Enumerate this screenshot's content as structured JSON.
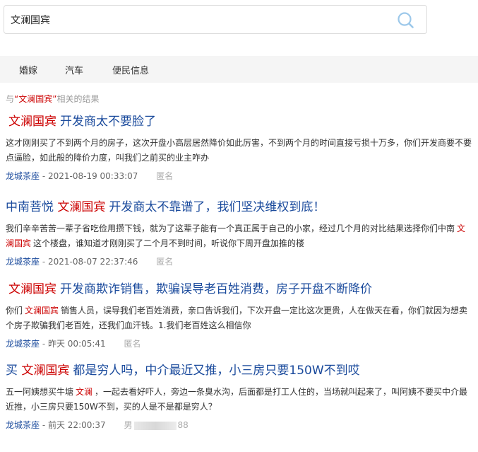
{
  "search": {
    "value": "文澜国宾",
    "button_icon": "search-icon"
  },
  "tabs": [
    "婚嫁",
    "汽车",
    "便民信息"
  ],
  "summary": {
    "prefix": "与",
    "query_quoted": "“文澜国宾”",
    "suffix": "相关的结果"
  },
  "results": [
    {
      "title_pre": "",
      "title_hl": "文澜国宾",
      "title_post": "开发商太不要脸了",
      "snippet": [
        {
          "t": "text",
          "v": "这才刚刚买了不到两个月的房子，这次开盘小高层居然降价如此厉害，不到两个月的时间直接亏损十万多，你们开发商要不要点逼脸，如此般的降价力度，叫我们之前买的业主咋办"
        }
      ],
      "author": "龙城茶座",
      "time": "2021-08-19 00:33:07",
      "anon": "匿名"
    },
    {
      "title_pre": "中南菩悦",
      "title_hl": "文澜国宾",
      "title_post": "开发商太不靠谱了，我们坚决维权到底！",
      "snippet": [
        {
          "t": "text",
          "v": "我们辛辛苦苦一辈子省吃俭用攒下钱，就为了这辈子能有一个真正属于自己的小家，经过几个月的对比结果选择你们中南"
        },
        {
          "t": "hl",
          "v": "文澜国宾"
        },
        {
          "t": "text",
          "v": "这个楼盘，谁知道才刚刚买了二个月不到时间，听说你下周开盘加推的楼"
        }
      ],
      "author": "龙城茶座",
      "time": "2021-08-07 22:37:46",
      "anon": "匿名"
    },
    {
      "title_pre": "",
      "title_hl": "文澜国宾",
      "title_post": "开发商欺诈销售，欺骗误导老百姓消费，房子开盘不断降价",
      "snippet": [
        {
          "t": "text",
          "v": "你们"
        },
        {
          "t": "hl",
          "v": "文澜国宾"
        },
        {
          "t": "text",
          "v": "销售人员，误导我们老百姓消费，亲口告诉我们，下次开盘一定比这次更贵，人在做天在看，你们就因为想卖个房子欺骗我们老百姓，还我们血汗钱。1.我们老百姓这么相信你"
        }
      ],
      "author": "龙城茶座",
      "time": "昨天 00:05:41",
      "anon": "匿名"
    },
    {
      "title_pre": "买",
      "title_hl": "文澜国宾",
      "title_post": "都是穷人吗，中介最近又推，小三房只要150W不到哎",
      "snippet": [
        {
          "t": "text",
          "v": "五一阿姨想买牛塘"
        },
        {
          "t": "hl",
          "v": "文澜"
        },
        {
          "t": "text",
          "v": "，一起去看好吓人，旁边一条臭水沟，后面都是打工人住的，当场就叫起来了，叫阿姨不要买中介最近推，小三房只要150W不到，买的人是不是都是穷人？"
        }
      ],
      "author": "龙城茶座",
      "time": "前天 22:00:37",
      "anon_prefix": "男",
      "anon_suffix": "88"
    }
  ]
}
